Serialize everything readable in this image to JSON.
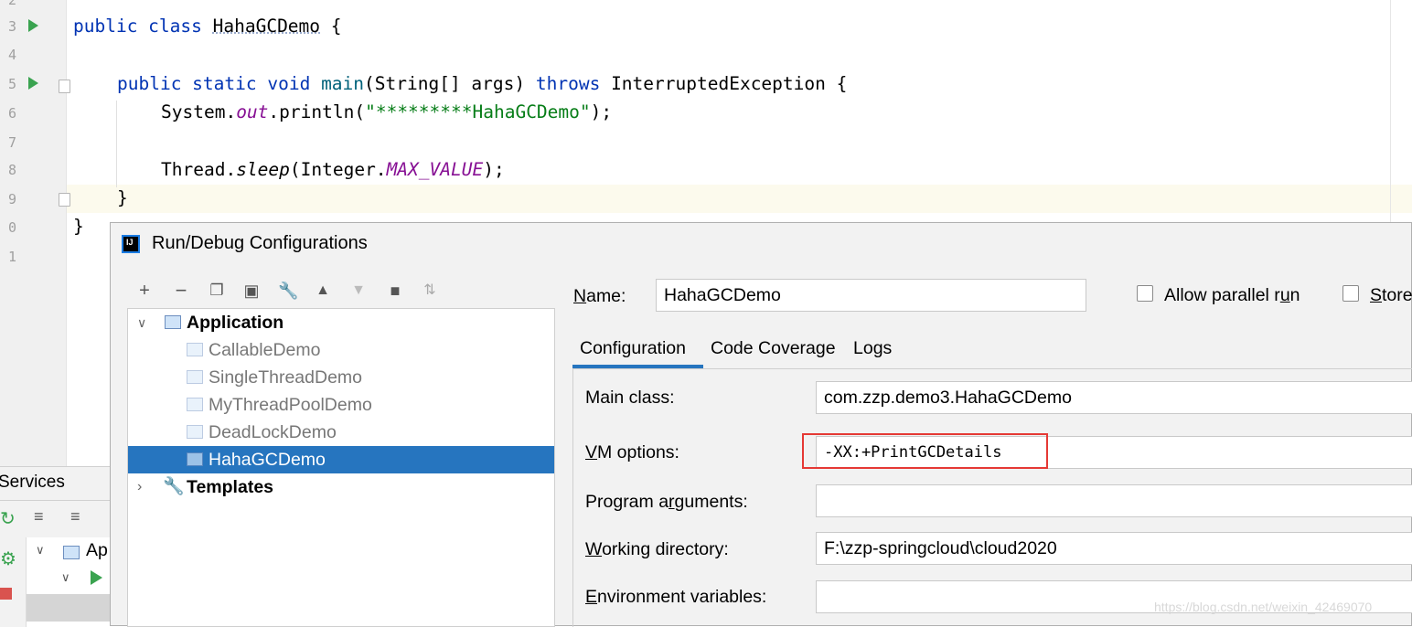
{
  "editor": {
    "line_numbers": [
      "2",
      "3",
      "4",
      "5",
      "6",
      "7",
      "8",
      "9",
      "0",
      "1"
    ],
    "lines": {
      "l3": {
        "kw1": "public class ",
        "name": "HahaGCDemo",
        " rest": " {",
        "rest": " {"
      },
      "l5": {
        "kw1": "public static void ",
        "method": "main",
        "args": "(String[] args) ",
        "kw2": "throws",
        "rest": " InterruptedException {"
      },
      "l6": {
        "a": "System.",
        "b": "out",
        "c": ".println(",
        "str": "\"*********HahaGCDemo\"",
        "d": ");"
      },
      "l8": {
        "a": "Thread.",
        "b": "sleep",
        "c": "(Integer.",
        "d": "MAX_VALUE",
        "e": ");"
      },
      "l9": "}",
      "l10": "}"
    }
  },
  "services": {
    "title": "Services",
    "tree_label": "Ap"
  },
  "dialog": {
    "title": "Run/Debug Configurations",
    "logo_text": "IJ",
    "toolbar_icons": [
      "add-icon",
      "remove-icon",
      "copy-icon",
      "save-icon",
      "wrench-icon",
      "move-up-icon",
      "move-down-icon",
      "folder-icon",
      "sort-icon"
    ],
    "tree": {
      "application_label": "Application",
      "items": [
        "CallableDemo",
        "SingleThreadDemo",
        "MyThreadPoolDemo",
        "DeadLockDemo",
        "HahaGCDemo"
      ],
      "selected": "HahaGCDemo",
      "templates_label": "Templates"
    },
    "name_label_first": "N",
    "name_label_rest": "ame:",
    "name_value": "HahaGCDemo",
    "allow_parallel_a": "Allow parallel r",
    "allow_parallel_b": "u",
    "allow_parallel_c": "n",
    "store_label_first": "S",
    "store_label_rest": "tore",
    "tabs": [
      "Configuration",
      "Code Coverage",
      "Logs"
    ],
    "active_tab": "Configuration",
    "fields": {
      "main_class": {
        "label": "Main class:",
        "value": "com.zzp.demo3.HahaGCDemo"
      },
      "vm_options": {
        "label_first": "V",
        "label_rest": "M options:",
        "value": "-XX:+PrintGCDetails"
      },
      "program_arguments": {
        "label_a": "Program a",
        "label_b": "r",
        "label_c": "guments:",
        "value": ""
      },
      "working_directory": {
        "label_first": "W",
        "label_rest": "orking directory:",
        "value": "F:\\zzp-springcloud\\cloud2020"
      },
      "environment_variables": {
        "label_first": "E",
        "label_rest": "nvironment variables:",
        "value": ""
      }
    },
    "highlight_color": "#e53935",
    "selection_color": "#2675bf"
  },
  "watermark": "https://blog.csdn.net/weixin_42469070"
}
